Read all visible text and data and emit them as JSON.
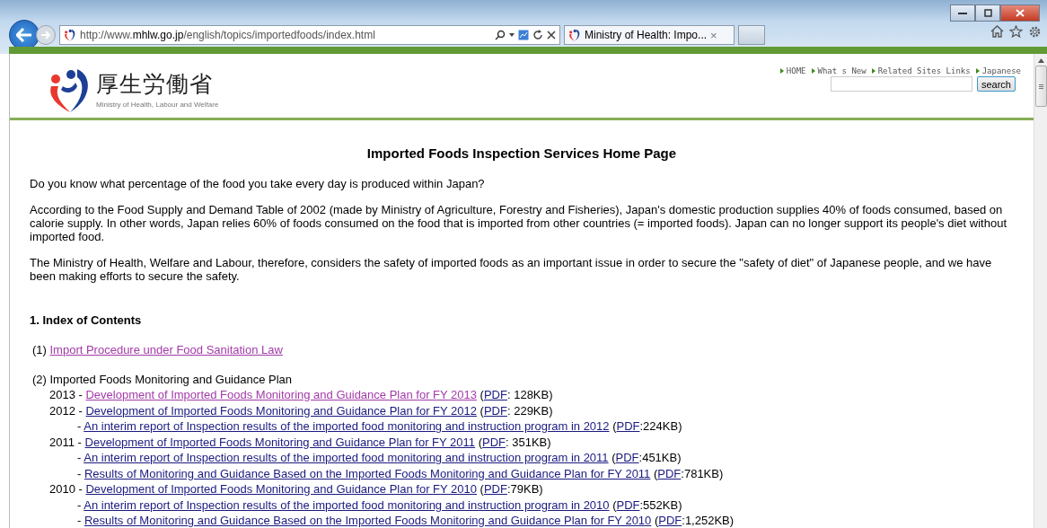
{
  "browser": {
    "url_parts": [
      {
        "text": "http://www.",
        "bold": false
      },
      {
        "text": "mhlw.go.jp",
        "bold": true
      },
      {
        "text": "/english/topics/importedfoods/index.html",
        "bold": false
      }
    ],
    "tab_title": "Ministry of Health: Impo...",
    "tab_close": "×"
  },
  "header": {
    "logo_text": "厚生労働省",
    "logo_subtitle": "Ministry of Health, Labour and Welfare",
    "nav": [
      {
        "label": "HOME"
      },
      {
        "label": "What s New"
      },
      {
        "label": "Related Sites Links"
      },
      {
        "label": "Japanese"
      }
    ],
    "search_button": "search"
  },
  "title": "Imported Foods Inspection Services Home Page",
  "paragraphs": [
    "Do you know what percentage of the food you take every day is produced within Japan?",
    "According to the Food Supply and Demand Table of 2002 (made by Ministry of Agriculture, Forestry and Fisheries), Japan's domestic production supplies 40% of foods consumed, based on calorie supply. In other words, Japan relies 60% of foods consumed on the food that is imported from other countries (= imported foods). Japan can no longer support its people's diet without imported food.",
    "The Ministry of Health, Welfare and Labour, therefore, considers the safety of imported foods as an important issue in order to secure the \"safety of diet\" of Japanese people, and we have been making efforts to secure the safety."
  ],
  "section_heading": "1. Index of Contents",
  "index": [
    {
      "number": "(1)",
      "link": "Import Procedure under Food Sanitation Law",
      "visited": true
    },
    {
      "number": "(2)",
      "text": "Imported Foods Monitoring and Guidance Plan"
    }
  ],
  "plan": [
    {
      "year": "2013",
      "entries": [
        {
          "dash": "-",
          "link": "Development of Imported Foods Monitoring and Guidance Plan for FY 2013",
          "visited": true,
          "open": "(",
          "pdf": "PDF",
          "close": ": 128KB)"
        }
      ]
    },
    {
      "year": "2012",
      "entries": [
        {
          "dash": "-",
          "link": "Development of Imported Foods Monitoring and Guidance Plan for FY 2012",
          "visited": false,
          "open": "(",
          "pdf": "PDF",
          "close": ": 229KB)"
        },
        {
          "dash": "-",
          "link": "An interim report of Inspection results of the imported food monitoring and instruction program in 2012",
          "visited": false,
          "open": "(",
          "pdf": "PDF",
          "close": ":224KB)"
        }
      ]
    },
    {
      "year": "2011",
      "entries": [
        {
          "dash": "-",
          "link": "Development of Imported Foods Monitoring and Guidance Plan for FY 2011",
          "visited": false,
          "open": "(",
          "pdf": "PDF",
          "close": ": 351KB)"
        },
        {
          "dash": "-",
          "link": "An interim report of Inspection results of the imported food monitoring and instruction program in 2011",
          "visited": false,
          "open": "(",
          "pdf": "PDF",
          "close": ":451KB)"
        },
        {
          "dash": "-",
          "link": "Results of Monitoring and Guidance Based on the Imported Foods Monitoring and Guidance Plan for FY 2011",
          "visited": false,
          "open": "(",
          "pdf": "PDF",
          "close": ":781KB)"
        }
      ]
    },
    {
      "year": "2010",
      "entries": [
        {
          "dash": "-",
          "link": "Development of Imported Foods Monitoring and Guidance Plan for FY 2010",
          "visited": false,
          "open": "(",
          "pdf": "PDF",
          "close": ":79KB)"
        },
        {
          "dash": "-",
          "link": "An interim report of Inspection results of the imported food monitoring and instruction program in 2010",
          "visited": false,
          "open": "(",
          "pdf": "PDF",
          "close": ":552KB)"
        },
        {
          "dash": "-",
          "link": "Results of Monitoring and Guidance Based on the Imported Foods Monitoring and Guidance Plan for FY 2010",
          "visited": false,
          "open": "(",
          "pdf": "PDF",
          "close": ":1,252KB)"
        }
      ]
    }
  ]
}
